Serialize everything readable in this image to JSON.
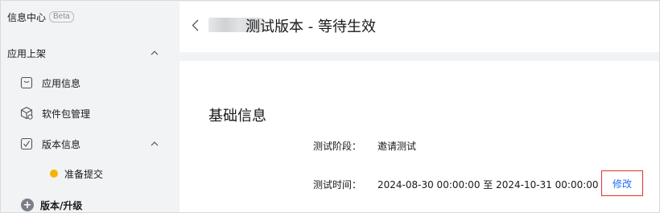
{
  "sidebar": {
    "top_label": "信息中心",
    "top_badge": "Beta",
    "group_label": "应用上架",
    "items": [
      {
        "label": "应用信息",
        "icon": "app-info-icon"
      },
      {
        "label": "软件包管理",
        "icon": "package-icon"
      },
      {
        "label": "版本信息",
        "icon": "version-icon"
      }
    ],
    "sub_item": {
      "label": "准备提交",
      "status_color": "#f5b400"
    },
    "bottom_label": "版本/升级"
  },
  "header": {
    "title": "测试版本 - 等待生效"
  },
  "content": {
    "section_title": "基础信息",
    "fields": [
      {
        "label": "测试阶段：",
        "value": "邀请测试"
      },
      {
        "label": "测试时间：",
        "value": "2024-08-30 00:00:00 至 2024-10-31 00:00:00"
      }
    ],
    "edit_label": "修改"
  },
  "colors": {
    "accent": "#1f6bff",
    "highlight_border": "#e0302d",
    "status_dot": "#f5b400",
    "sidebar_bg": "#f1f3f5"
  }
}
